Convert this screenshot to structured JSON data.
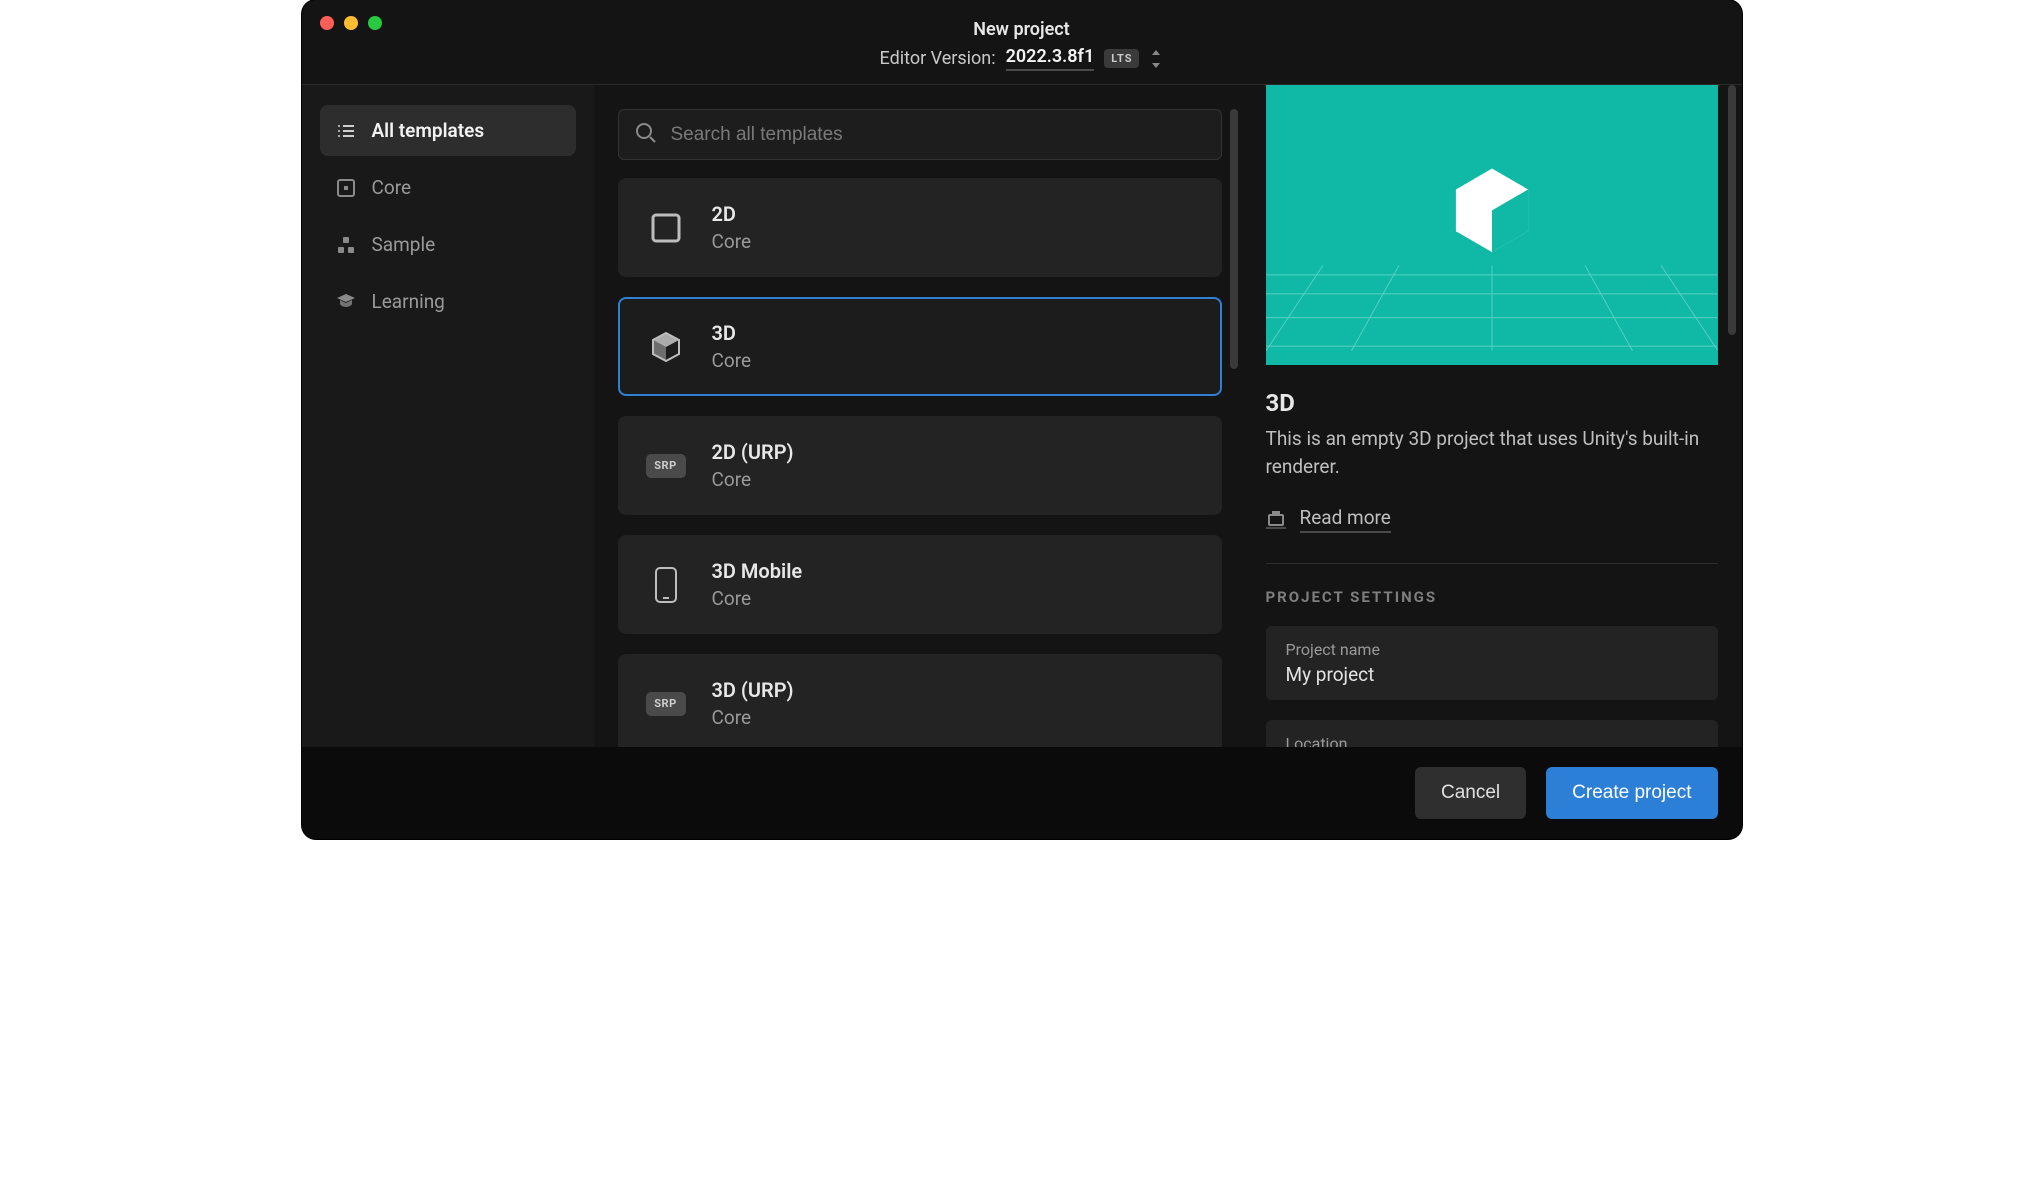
{
  "window": {
    "title": "New project",
    "editor_version_label": "Editor Version:",
    "editor_version": "2022.3.8f1",
    "lts_badge": "LTS"
  },
  "sidebar": {
    "items": [
      {
        "id": "all",
        "label": "All templates",
        "active": true
      },
      {
        "id": "core",
        "label": "Core",
        "active": false
      },
      {
        "id": "sample",
        "label": "Sample",
        "active": false
      },
      {
        "id": "learning",
        "label": "Learning",
        "active": false
      }
    ]
  },
  "search": {
    "placeholder": "Search all templates"
  },
  "templates": [
    {
      "id": "2d",
      "title": "2D",
      "subtitle": "Core",
      "icon": "square",
      "selected": false
    },
    {
      "id": "3d",
      "title": "3D",
      "subtitle": "Core",
      "icon": "cube",
      "selected": true
    },
    {
      "id": "2d-urp",
      "title": "2D (URP)",
      "subtitle": "Core",
      "icon": "srp",
      "selected": false
    },
    {
      "id": "3d-mobile",
      "title": "3D Mobile",
      "subtitle": "Core",
      "icon": "mobile",
      "selected": false
    },
    {
      "id": "3d-urp",
      "title": "3D (URP)",
      "subtitle": "Core",
      "icon": "srp",
      "selected": false
    }
  ],
  "details": {
    "title": "3D",
    "description": "This is an empty 3D project that uses Unity's built-in renderer.",
    "read_more": "Read more",
    "section_label": "PROJECT SETTINGS",
    "project_name_label": "Project name",
    "project_name_value": "My project",
    "location_label": "Location"
  },
  "footer": {
    "cancel": "Cancel",
    "create": "Create project"
  },
  "colors": {
    "accent": "#2b7fd6",
    "preview_bg": "#0fb9a6"
  }
}
